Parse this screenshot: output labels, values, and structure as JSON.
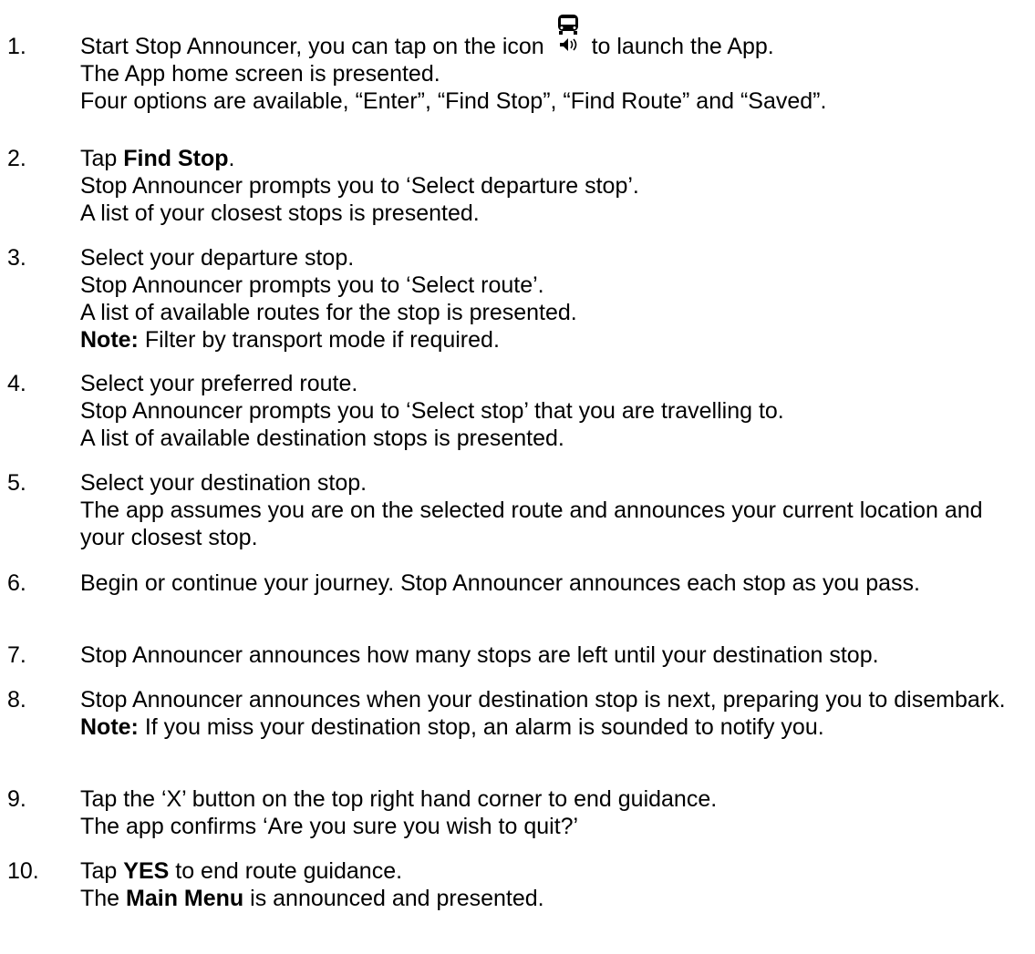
{
  "steps": [
    {
      "number": "1.",
      "lines": [
        {
          "before": "Start Stop Announcer, you can tap on the icon ",
          "icon": "bus-speaker-icon",
          "after": " to launch the App."
        },
        {
          "text": "The App home screen is presented."
        },
        {
          "text": "Four options are available, “Enter”, “Find Stop”, “Find Route” and “Saved”."
        }
      ]
    },
    {
      "number": "2.",
      "lines": [
        {
          "plain": "Tap ",
          "bold": "Find Stop",
          "after": "."
        },
        {
          "text": "Stop Announcer prompts you to ‘Select departure stop’."
        },
        {
          "text": "A list of your closest stops is presented."
        }
      ]
    },
    {
      "number": "3.",
      "lines": [
        {
          "text": "Select your departure stop."
        },
        {
          "text": "Stop Announcer prompts you to ‘Select route’."
        },
        {
          "text": "A list of available routes for the stop is presented."
        },
        {
          "bold": "Note:",
          "after": " Filter by transport mode if required."
        }
      ]
    },
    {
      "number": "4.",
      "lines": [
        {
          "text": "Select your preferred route."
        },
        {
          "text": "Stop Announcer prompts you to ‘Select stop’ that you are travelling to."
        },
        {
          "text": "A list of available destination stops is presented."
        }
      ]
    },
    {
      "number": "5.",
      "lines": [
        {
          "text": "Select your destination stop."
        },
        {
          "text": "The app assumes you are on the selected route and announces your current location and your closest stop."
        }
      ]
    },
    {
      "number": "6.",
      "lines": [
        {
          "text": "Begin or continue your journey. Stop Announcer announces each stop as you pass."
        }
      ]
    },
    {
      "number": "7.",
      "lines": [
        {
          "text": "Stop Announcer announces how many stops are left until your destination stop."
        }
      ]
    },
    {
      "number": "8.",
      "lines": [
        {
          "text": "Stop Announcer announces when your destination stop is next, preparing you to disembark."
        },
        {
          "bold": "Note:",
          "after": " If you miss your destination stop, an alarm is sounded to notify you."
        }
      ]
    },
    {
      "number": "9.",
      "lines": [
        {
          "text": "Tap the ‘X’ button on the top right hand corner to end guidance."
        },
        {
          "text": "The app confirms ‘Are you sure you wish to quit?’"
        }
      ]
    },
    {
      "number": "10.",
      "lines": [
        {
          "plain": "Tap ",
          "bold": "YES",
          "after": " to end route guidance."
        },
        {
          "plain": "The ",
          "bold": "Main Menu",
          "after": " is announced and presented."
        }
      ]
    }
  ]
}
